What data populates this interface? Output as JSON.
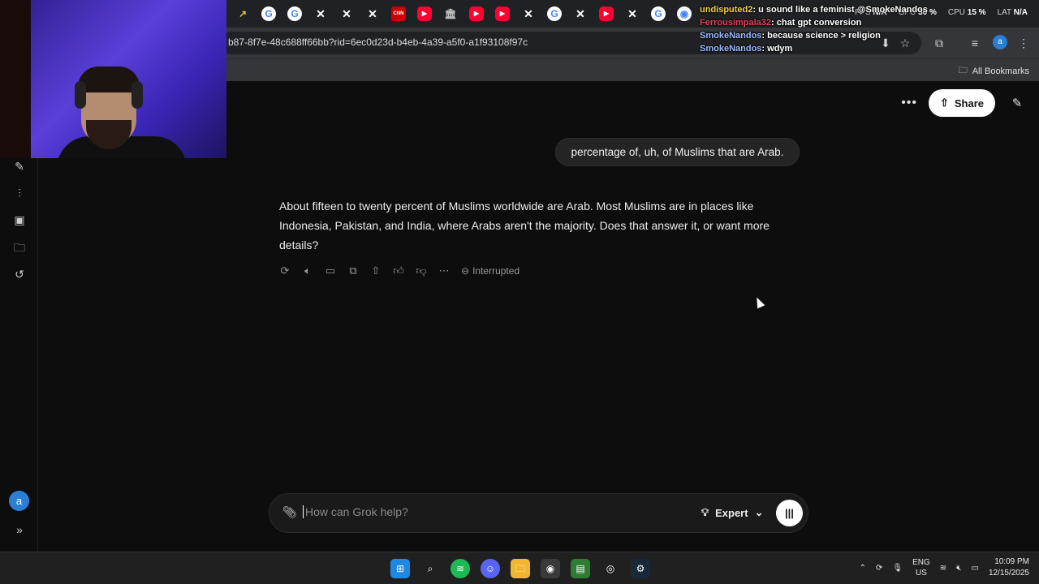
{
  "browser": {
    "url": "b87-8f7e-48c688ff66bb?rid=6ec0d23d-b4eb-4a39-a5f0-a1f93108f97c",
    "bookmarks_label": "All Bookmarks",
    "profile_initial": "a",
    "tabs": [
      "trend",
      "google",
      "google",
      "x",
      "x",
      "x",
      "cnn",
      "youtube",
      "bank",
      "youtube",
      "youtube",
      "x",
      "google",
      "x",
      "youtube",
      "x",
      "google",
      "chrome"
    ],
    "tab_texts": {
      "cnn": "CNN"
    }
  },
  "stats": {
    "fps_label": "FPS",
    "fps_value": "N/A",
    "gpu_label": "GPU",
    "gpu_value": "30 %",
    "cpu_label": "CPU",
    "cpu_value": "15 %",
    "lat_label": "LAT",
    "lat_value": "N/A"
  },
  "chat_overlay": [
    {
      "user": "undisputed2",
      "message": "u sound like a feminist @SmokeNandos"
    },
    {
      "user": "Ferrousimpala32",
      "message": "chat gpt conversion"
    },
    {
      "user": "SmokeNandos",
      "message": "because science > religion"
    },
    {
      "user": "SmokeNandos",
      "message": "wdym"
    }
  ],
  "app": {
    "share_label": "Share",
    "user_message": "percentage of, uh, of Muslims that are Arab.",
    "assistant_message": "About fifteen to twenty percent of Muslims worldwide are Arab. Most Muslims are in places like Indonesia, Pakistan, and India, where Arabs aren't the majority. Does that answer it, or want more details?",
    "status_label": "Interrupted",
    "composer_placeholder": "How can Grok help?",
    "mode_label": "Expert",
    "avatar_initial": "a"
  },
  "taskbar": {
    "lang_top": "ENG",
    "lang_bottom": "US",
    "time": "10:09 PM",
    "date": "12/15/2025"
  },
  "colors": {
    "background": "#0d0d0d",
    "bubble": "#242424",
    "accent_avatar": "#2a7fd4"
  }
}
